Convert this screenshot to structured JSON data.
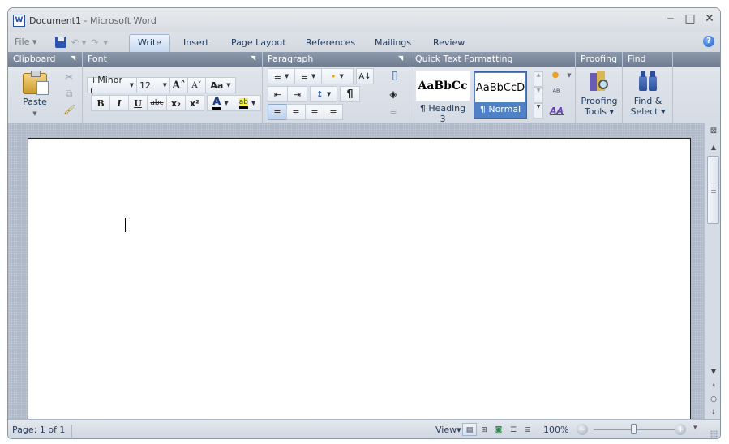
{
  "window": {
    "title_doc": "Document1",
    "title_sep": " - ",
    "title_app": "Microsoft Word",
    "minimize_glyph": "‒",
    "maximize_glyph": "□",
    "close_glyph": "✕"
  },
  "tabs": {
    "file_label": "File ▾",
    "qat": {
      "save_icon": "save-icon",
      "undo_glyph": "↶ ▾",
      "redo_glyph": "↷",
      "customize_glyph": "▾"
    },
    "items": [
      {
        "label": "Write",
        "active": true
      },
      {
        "label": "Insert"
      },
      {
        "label": "Page Layout"
      },
      {
        "label": "References"
      },
      {
        "label": "Mailings"
      },
      {
        "label": "Review"
      }
    ],
    "help_glyph": "?"
  },
  "ribbon": {
    "clipboard": {
      "header": "Clipboard",
      "paste_label": "Paste",
      "cut_glyph": "✂",
      "copy_glyph": "⧉",
      "format_painter_glyph": "🖌"
    },
    "font": {
      "header": "Font",
      "font_name": "+Minor (",
      "font_size": "12",
      "grow_glyph": "A˄",
      "shrink_glyph": "A˅",
      "change_case": "Aa",
      "bold": "B",
      "italic": "I",
      "underline": "U",
      "strikethrough": "abc",
      "subscript": "x₂",
      "superscript": "x²",
      "font_color": "A",
      "highlight": "ab"
    },
    "paragraph": {
      "header": "Paragraph",
      "numbering_glyph": "≡",
      "bullets_glyph": "≡",
      "multilevel_glyph": "•",
      "sort_glyph": "A↓",
      "decrease_indent_glyph": "⇤",
      "increase_indent_glyph": "⇥",
      "line_spacing_glyph": "↕",
      "show_marks_glyph": "¶",
      "align_left_glyph": "≡",
      "center_glyph": "≡",
      "align_right_glyph": "≡",
      "justify_glyph": "≡",
      "page_glyph": "▯",
      "shading_glyph": "◈"
    },
    "quick_text": {
      "header": "Quick Text Formatting",
      "styles": [
        {
          "preview": "AaBbCc",
          "name": "¶ Heading 3"
        },
        {
          "preview": "AaBbCcD",
          "name": "¶ Normal",
          "selected": true
        }
      ]
    },
    "proofing": {
      "header": "Proofing",
      "label_line1": "Proofing",
      "label_line2": "Tools ▾"
    },
    "find": {
      "header": "Find",
      "label_line1": "Find &",
      "label_line2": "Select ▾"
    }
  },
  "document": {
    "content": ""
  },
  "status": {
    "page": "Page: 1 of 1",
    "view_label": "View▾",
    "zoom_percent": "100%",
    "zoom_value": 100,
    "zoom_minus": "−",
    "zoom_plus": "+"
  }
}
